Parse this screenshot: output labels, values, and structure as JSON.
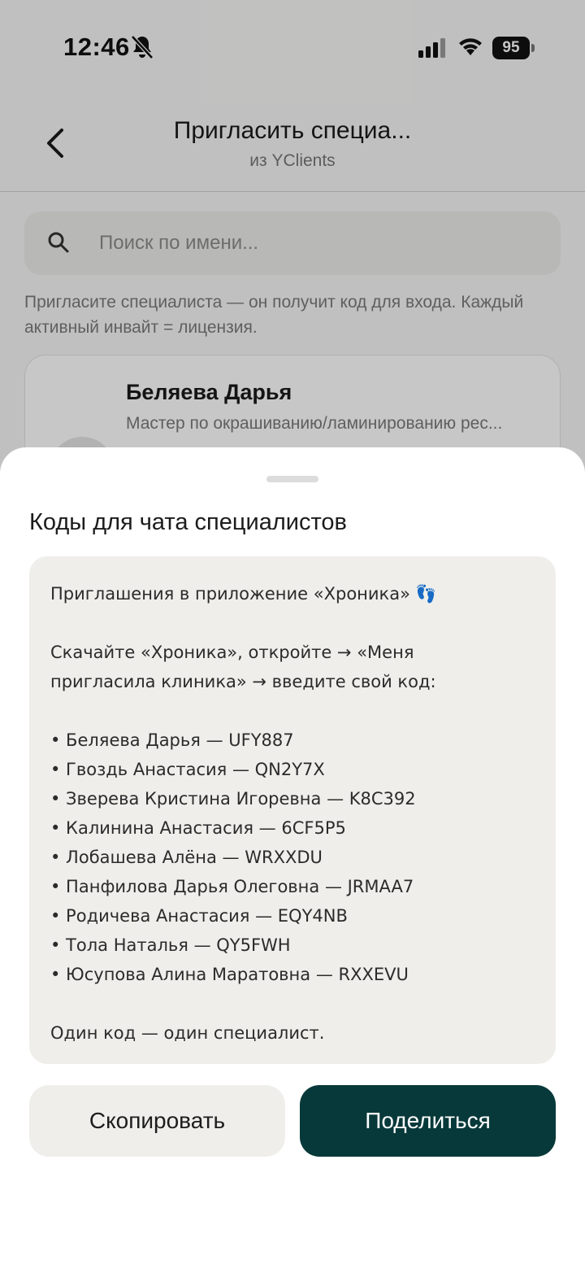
{
  "status_bar": {
    "time": "12:46",
    "battery": "95"
  },
  "header": {
    "title": "Пригласить специа...",
    "subtitle": "из YClients"
  },
  "search": {
    "placeholder": "Поиск по имени..."
  },
  "info_text": "Пригласите специалиста — он получит код для входа. Каждый активный инвайт = лицензия.",
  "background_card": {
    "name": "Беляева Дарья",
    "role": "Мастер по окрашиванию/ламинированию рес..."
  },
  "sheet": {
    "title": "Коды для чата специалистов",
    "message": {
      "heading": "Приглашения в приложение «Хроника»",
      "heading_icon": "👣",
      "instruction_line1": "Скачайте «Хроника», откройте → «Меня",
      "instruction_line2": "пригласила клиника» → введите свой код:",
      "codes": [
        "• Беляева Дарья — UFY887",
        "• Гвоздь Анастасия — QN2Y7X",
        "• Зверева Кристина Игоревна — K8C392",
        "• Калинина Анастасия — 6CF5P5",
        "• Лобашева Алёна — WRXXDU",
        "• Панфилова Дарья Олеговна — JRMAA7",
        "• Родичева Анастасия — EQY4NB",
        "• Тола Наталья — QY5FWH",
        "• Юсупова Алина Маратовна — RXXEVU"
      ],
      "footer": "Один код — один специалист."
    },
    "copy_label": "Скопировать",
    "share_label": "Поделиться"
  },
  "colors": {
    "accent": "#08393a",
    "sheet_box": "#efeeea"
  }
}
